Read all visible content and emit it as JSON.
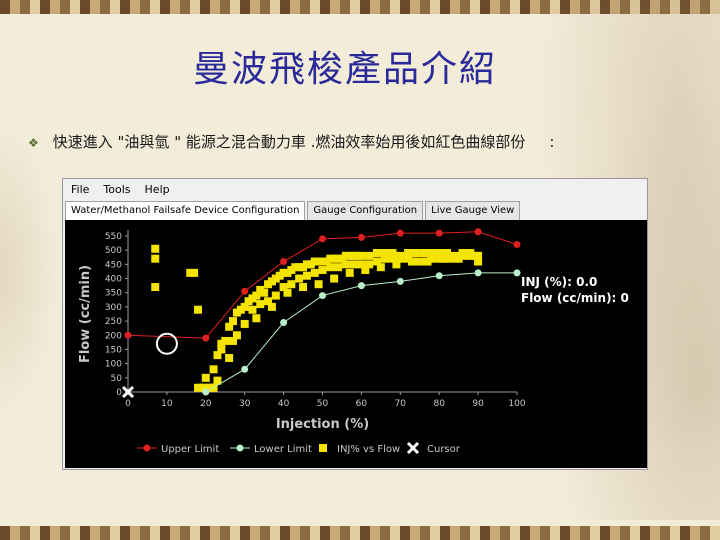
{
  "slide": {
    "title": "曼波飛梭產品介紹",
    "bullet_text": "快速進入 \"油與氫 \" 能源之混合動力車 .燃油效率始用後如紅色曲線部份",
    "bullet_tail": ":"
  },
  "app": {
    "menu": [
      "File",
      "Tools",
      "Help"
    ],
    "tabs": [
      {
        "label": "Water/Methanol Failsafe Device Configuration",
        "active": true
      },
      {
        "label": "Gauge Configuration",
        "active": false
      },
      {
        "label": "Live Gauge View",
        "active": false
      }
    ],
    "readout": {
      "inj": "INJ (%): 0.0",
      "flow": "Flow (cc/min): 0"
    }
  },
  "chart_data": {
    "type": "scatter",
    "xlabel": "Injection (%)",
    "ylabel": "Flow (cc/min)",
    "xlim": [
      0,
      100
    ],
    "ylim": [
      0,
      550
    ],
    "x_ticks": [
      0,
      10,
      20,
      30,
      40,
      50,
      60,
      70,
      80,
      90,
      100
    ],
    "y_ticks": [
      0,
      50,
      100,
      150,
      200,
      250,
      300,
      350,
      400,
      450,
      500,
      550
    ],
    "colors": {
      "upper": "#e02020",
      "lower": "#b8f0c8",
      "scatter": "#f5e400",
      "cursor": "#ffffff",
      "background": "#000000",
      "axis_text": "#c8c8c8"
    },
    "series": [
      {
        "name": "Upper Limit",
        "type": "line",
        "x": [
          0,
          20,
          30,
          40,
          50,
          60,
          70,
          80,
          90,
          100
        ],
        "y": [
          200,
          190,
          355,
          460,
          540,
          545,
          560,
          560,
          565,
          520
        ]
      },
      {
        "name": "Lower Limit",
        "type": "line",
        "x": [
          20,
          30,
          40,
          50,
          60,
          70,
          80,
          90,
          100
        ],
        "y": [
          0,
          80,
          245,
          340,
          375,
          390,
          410,
          420,
          420
        ]
      },
      {
        "name": "INJ% vs Flow",
        "type": "scatter",
        "x": [
          7,
          7,
          7,
          16,
          17,
          18,
          20,
          22,
          23,
          24,
          25,
          26,
          27,
          28,
          29,
          30,
          31,
          32,
          33,
          34,
          35,
          36,
          37,
          38,
          39,
          40,
          41,
          42,
          43,
          44,
          45,
          46,
          47,
          48,
          49,
          50,
          51,
          52,
          53,
          54,
          55,
          56,
          57,
          58,
          59,
          60,
          62,
          64,
          66,
          68,
          70,
          72,
          74,
          76,
          78,
          80,
          82,
          84,
          86,
          88,
          90,
          26,
          28,
          30,
          32,
          34,
          36,
          38,
          40,
          42,
          44,
          46,
          48,
          50,
          52,
          54,
          56,
          58,
          60,
          62,
          64,
          66,
          68,
          70,
          72,
          74,
          76,
          78,
          80,
          82,
          84,
          86,
          88,
          90,
          24,
          27,
          33,
          37,
          41,
          45,
          49,
          53,
          57,
          61,
          65,
          69,
          73,
          77,
          81,
          85,
          89,
          18,
          19,
          20,
          21,
          22,
          23
        ],
        "y": [
          470,
          505,
          370,
          420,
          420,
          290,
          50,
          80,
          130,
          170,
          180,
          230,
          250,
          280,
          290,
          300,
          320,
          330,
          340,
          360,
          350,
          380,
          390,
          400,
          410,
          420,
          420,
          430,
          440,
          440,
          440,
          450,
          450,
          460,
          460,
          460,
          460,
          470,
          470,
          470,
          470,
          480,
          480,
          480,
          480,
          480,
          480,
          490,
          490,
          490,
          480,
          490,
          490,
          490,
          490,
          490,
          490,
          480,
          490,
          490,
          480,
          120,
          200,
          240,
          290,
          310,
          320,
          340,
          370,
          380,
          400,
          410,
          420,
          430,
          440,
          440,
          450,
          450,
          450,
          450,
          460,
          470,
          470,
          470,
          470,
          460,
          460,
          470,
          470,
          470,
          470,
          480,
          480,
          460,
          150,
          180,
          260,
          300,
          350,
          370,
          380,
          400,
          420,
          430,
          440,
          450,
          460,
          460,
          470,
          470,
          480,
          15,
          15,
          15,
          15,
          15,
          40
        ]
      },
      {
        "name": "Cursor",
        "type": "marker",
        "x": [
          0
        ],
        "y": [
          0
        ]
      }
    ],
    "legend": [
      "Upper Limit",
      "Lower Limit",
      "INJ% vs Flow",
      "Cursor"
    ],
    "legend_position": "bottom",
    "grid": false
  }
}
